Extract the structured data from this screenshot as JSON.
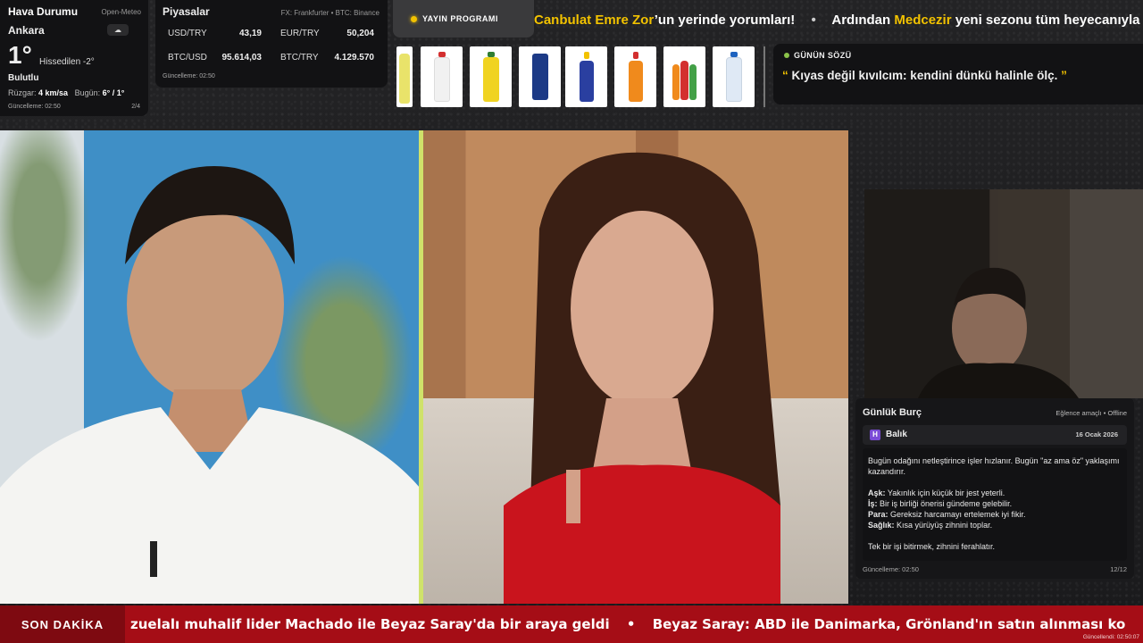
{
  "weather": {
    "title": "Hava Durumu",
    "source": "Open-Meteo",
    "city": "Ankara",
    "cloud_icon": "☁",
    "temperature": "1°",
    "feels_like": "Hissedilen -2°",
    "condition": "Bulutlu",
    "wind_label": "Rüzgar:",
    "wind_value": "4 km/sa",
    "today_label": "Bugün:",
    "today_value": "6° / 1°",
    "updated": "Güncelleme: 02:50",
    "page": "2/4"
  },
  "markets": {
    "title": "Piyasalar",
    "source": "FX: Frankfurter • BTC: Binance",
    "rows": [
      {
        "label": "USD/TRY",
        "value": "43,19"
      },
      {
        "label": "EUR/TRY",
        "value": "50,204"
      },
      {
        "label": "BTC/USD",
        "value": "95.614,03"
      },
      {
        "label": "BTC/TRY",
        "value": "4.129.570"
      }
    ],
    "updated": "Güncelleme: 02:50"
  },
  "broadcast": {
    "label": "YAYIN PROGRAMI"
  },
  "top_ticker": {
    "part1_hl": "Canbulat Emre Zor",
    "part1_rest": "’un yerinde yorumları!",
    "separator": "•",
    "part2_pre": "Ardından ",
    "part2_hl": "Medcezir",
    "part2_rest": " yeni sezonu tüm heyecanıyla"
  },
  "quote": {
    "heading": "GÜNÜN SÖZÜ",
    "open_mark": "“",
    "text": " Kıyas değil kıvılcım: kendini dünkü halinle ölç. ",
    "close_mark": "”"
  },
  "horoscope": {
    "title": "Günlük Burç",
    "mode": "Eğlence amaçlı • Offline",
    "sign_icon": "H",
    "sign": "Balık",
    "date": "16 Ocak 2026",
    "intro": "Bugün odağını netleştirince işler hızlanır. Bugün \"az ama öz\" yaklaşımı kazandırır.",
    "love_label": "Aşk:",
    "love": " Yakınlık için küçük bir jest yeterli.",
    "work_label": "İş:",
    "work": " Bir iş birliği önerisi gündeme gelebilir.",
    "money_label": "Para:",
    "money": " Gereksiz harcamayı ertelemek iyi fikir.",
    "health_label": "Sağlık:",
    "health": " Kısa yürüyüş zihnini toplar.",
    "closing": "Tek bir işi bitirmek, zihnini ferahlatır.",
    "updated": "Güncelleme: 02:50",
    "page": "12/12"
  },
  "breaking": {
    "label": "SON DAKİKA",
    "item1": "zuelalı muhalif lider Machado ile Beyaz Saray'da bir araya geldi",
    "separator": "•",
    "item2": "Beyaz Saray: ABD ile Danimarka, Grönland'ın satın alınması ko",
    "updated": "Güncellendi: 02:50:07"
  },
  "colors": {
    "accent": "#f2c200",
    "breaking_bg": "#a50d16",
    "panel_bg": "#121214",
    "divider_green": "#cfe26a"
  },
  "products": [
    {
      "name": "lemon-soda-bottle",
      "color": "#e9e36a",
      "cap": "#3a8a3a"
    },
    {
      "name": "strawberry-soda-bottle",
      "color": "#f1f1f1",
      "cap": "#d32f2f"
    },
    {
      "name": "yellow-soda-bottle",
      "color": "#f0d321",
      "cap": "#2f7d32"
    },
    {
      "name": "blue-cola-can",
      "color": "#1c3a86",
      "cap": "#1c3a86"
    },
    {
      "name": "blue-soda-bottle",
      "color": "#2a3fa0",
      "cap": "#f2c200"
    },
    {
      "name": "orange-soda-bottle",
      "color": "#f08a1c",
      "cap": "#d32f2f"
    },
    {
      "name": "multi-pack-bottles",
      "color": "#e64a19",
      "cap": "#43a047"
    },
    {
      "name": "water-bottle",
      "color": "#dfe9f5",
      "cap": "#1e63c0"
    }
  ]
}
